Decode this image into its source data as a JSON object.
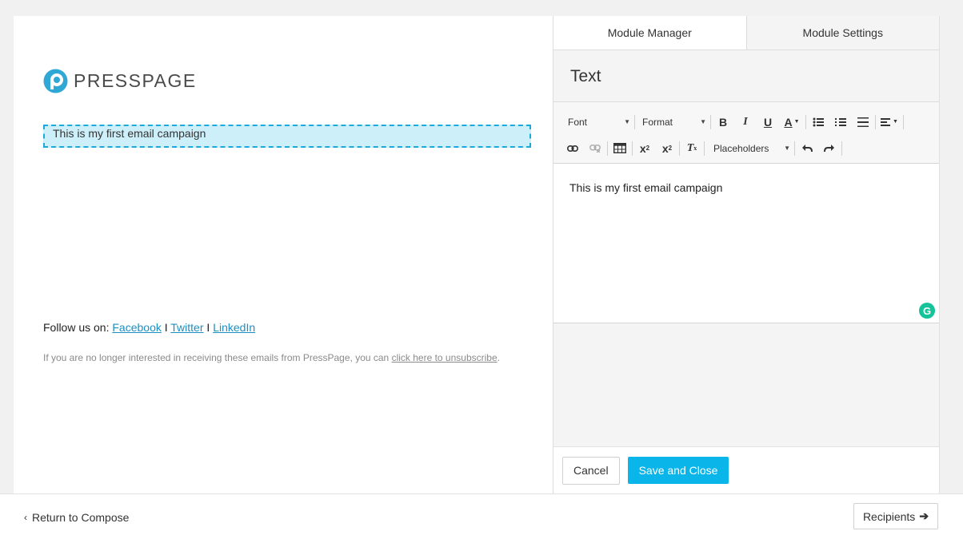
{
  "preview": {
    "logo_text": "PRESSPAGE",
    "text_block": "This is my first email campaign",
    "follow_prefix": "Follow us on: ",
    "follow_links": [
      "Facebook",
      "Twitter",
      "LinkedIn"
    ],
    "follow_sep": " I ",
    "unsubscribe_text": "If you are no longer interested in receiving these emails from PressPage, you can ",
    "unsubscribe_link": "click here to unsubscribe",
    "unsubscribe_end": "."
  },
  "panel": {
    "tabs": [
      "Module Manager",
      "Module Settings"
    ],
    "title": "Text",
    "toolbar": {
      "font_label": "Font",
      "format_label": "Format",
      "placeholders_label": "Placeholders"
    },
    "editor_text": "This is my first email campaign",
    "cancel_label": "Cancel",
    "save_label": "Save and Close"
  },
  "footer": {
    "return_label": "Return to Compose",
    "recipients_label": "Recipients"
  },
  "colors": {
    "accent": "#0ab5ea",
    "selection_bg": "#cdeffa",
    "selection_border": "#1ba9db",
    "link": "#1c8fc2",
    "grammarly": "#15c39a"
  }
}
